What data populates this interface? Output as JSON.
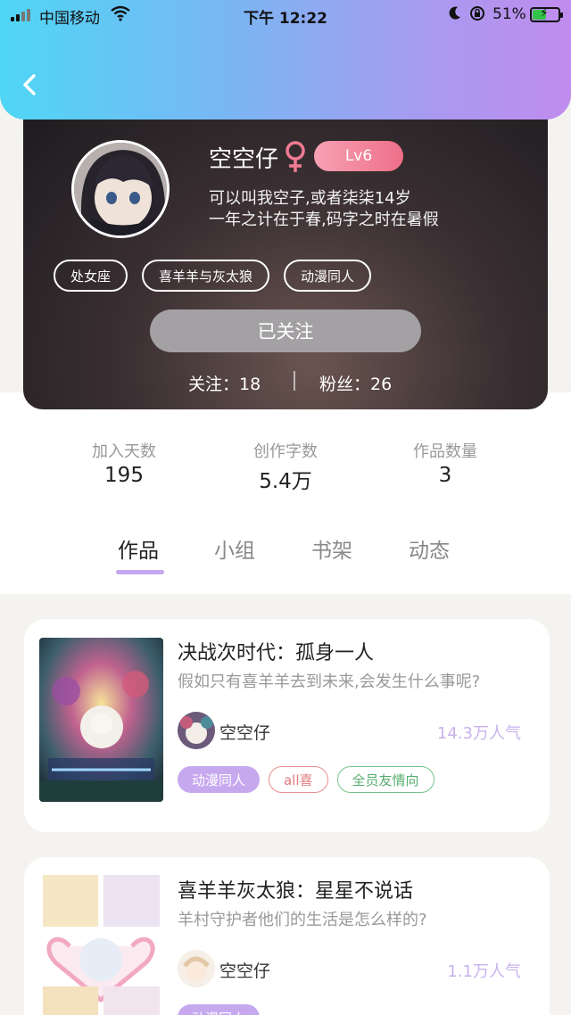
{
  "status_bar": {
    "carrier": "中国移动",
    "time": "下午 12:22",
    "battery": "51%",
    "battery_level": 0.51
  },
  "profile": {
    "nickname": "空空仔",
    "gender_icon": "female-icon",
    "level": "Lv6",
    "bio_line1": "可以叫我空子,或者柒柒14岁",
    "bio_line2": "一年之计在于春,码字之时在暑假",
    "tags": [
      "处女座",
      "喜羊羊与灰太狼",
      "动漫同人"
    ],
    "follow_button": "已关注",
    "following_label": "关注：18",
    "fans_label": "粉丝：26"
  },
  "stats": [
    {
      "label": "加入天数",
      "value": "195"
    },
    {
      "label": "创作字数",
      "value": "5.4万"
    },
    {
      "label": "作品数量",
      "value": "3"
    }
  ],
  "tabs": [
    "作品",
    "小组",
    "书架",
    "动态"
  ],
  "active_tab": "作品",
  "works": [
    {
      "title": "决战次时代：孤身一人",
      "description": "假如只有喜羊羊去到未来,会发生什么事呢?",
      "author": "空空仔",
      "popularity": "14.3万人气",
      "tags": [
        "动漫同人",
        "all喜",
        "全员友情向"
      ]
    },
    {
      "title": "喜羊羊灰太狼：星星不说话",
      "description": "羊村守护者他们的生活是怎么样的?",
      "author": "空空仔",
      "popularity": "1.1万人气",
      "tags": [
        "动漫同人"
      ]
    }
  ],
  "colors": {
    "accent": "#c6a8ef",
    "level_badge": "#f08aa0",
    "header_gradient_start": "#4fd6f5",
    "header_gradient_end": "#c08ced"
  }
}
